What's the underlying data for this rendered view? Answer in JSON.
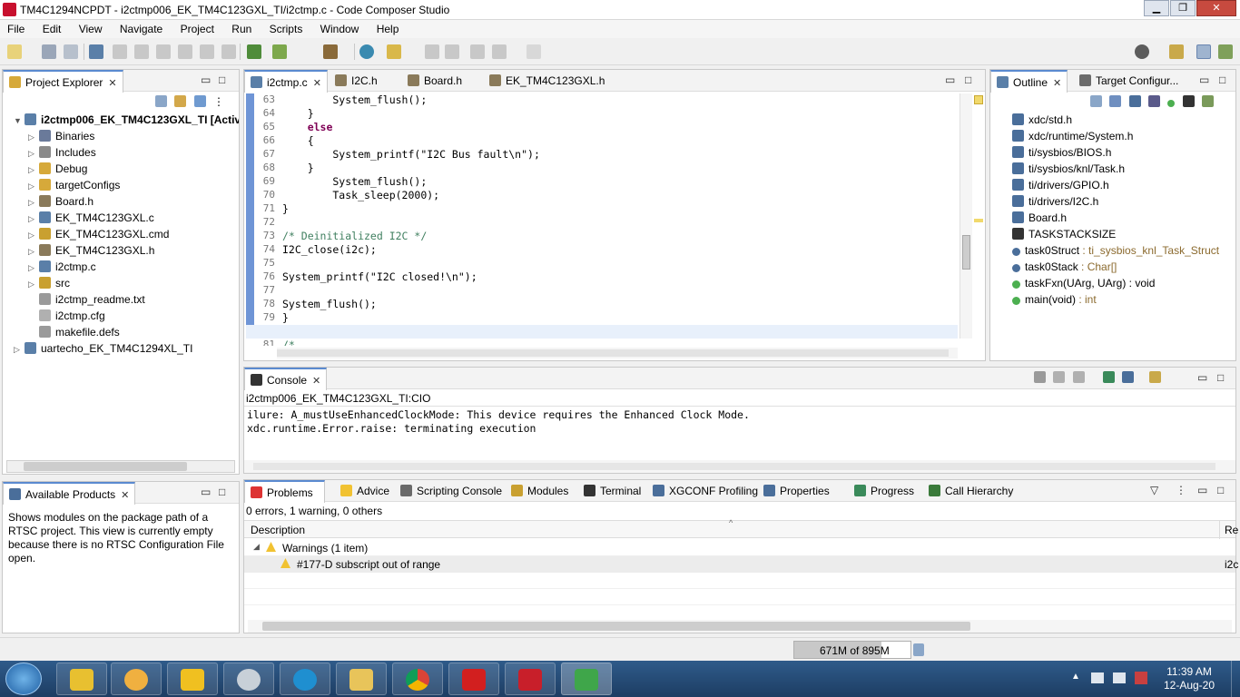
{
  "window": {
    "title": "TM4C1294NCPDT - i2ctmp006_EK_TM4C123GXL_TI/i2ctmp.c - Code Composer Studio",
    "min": "▁",
    "max": "❐",
    "close": "✕"
  },
  "menu": [
    "File",
    "Edit",
    "View",
    "Navigate",
    "Project",
    "Run",
    "Scripts",
    "Window",
    "Help"
  ],
  "project_explorer": {
    "title": "Project Explorer",
    "items": [
      {
        "label": "i2ctmp006_EK_TM4C123GXL_TI  [Active",
        "level": 0,
        "arrow": "▼",
        "bold": true
      },
      {
        "label": "Binaries",
        "level": 1,
        "arrow": "▷"
      },
      {
        "label": "Includes",
        "level": 1,
        "arrow": "▷"
      },
      {
        "label": "Debug",
        "level": 1,
        "arrow": "▷"
      },
      {
        "label": "targetConfigs",
        "level": 1,
        "arrow": "▷"
      },
      {
        "label": "Board.h",
        "level": 1,
        "arrow": "▷"
      },
      {
        "label": "EK_TM4C123GXL.c",
        "level": 1,
        "arrow": "▷"
      },
      {
        "label": "EK_TM4C123GXL.cmd",
        "level": 1,
        "arrow": "▷"
      },
      {
        "label": "EK_TM4C123GXL.h",
        "level": 1,
        "arrow": "▷"
      },
      {
        "label": "i2ctmp.c",
        "level": 1,
        "arrow": "▷"
      },
      {
        "label": "src",
        "level": 1,
        "arrow": "▷"
      },
      {
        "label": "i2ctmp_readme.txt",
        "level": 1,
        "arrow": ""
      },
      {
        "label": "i2ctmp.cfg",
        "level": 1,
        "arrow": ""
      },
      {
        "label": "makefile.defs",
        "level": 1,
        "arrow": ""
      },
      {
        "label": "uartecho_EK_TM4C1294XL_TI",
        "level": 0,
        "arrow": "▷"
      }
    ]
  },
  "available_products": {
    "title": "Available Products",
    "text": "Shows modules on the package path of a RTSC project. This view is currently empty because there is no RTSC Configuration File open."
  },
  "editor": {
    "tabs": [
      "i2ctmp.c",
      "I2C.h",
      "Board.h",
      "EK_TM4C123GXL.h"
    ],
    "lines": [
      {
        "n": "63",
        "code": "        System_flush();"
      },
      {
        "n": "64",
        "code": "    }"
      },
      {
        "n": "65",
        "code": "    else"
      },
      {
        "n": "66",
        "code": "    {"
      },
      {
        "n": "67",
        "code": "        System_printf(\"I2C Bus fault\\n\");"
      },
      {
        "n": "68",
        "code": "    }"
      },
      {
        "n": "69",
        "code": "        System_flush();"
      },
      {
        "n": "70",
        "code": "        Task_sleep(2000);"
      },
      {
        "n": "71",
        "code": "}"
      },
      {
        "n": "72",
        "code": ""
      },
      {
        "n": "73",
        "code": "/* Deinitialized I2C */"
      },
      {
        "n": "74",
        "code": "I2C_close(i2c);"
      },
      {
        "n": "75",
        "code": ""
      },
      {
        "n": "76",
        "code": "System_printf(\"I2C closed!\\n\");"
      },
      {
        "n": "77",
        "code": ""
      },
      {
        "n": "78",
        "code": "System_flush();"
      },
      {
        "n": "79",
        "code": "}"
      },
      {
        "n": "80",
        "code": ""
      },
      {
        "n": "81",
        "code": "/*"
      }
    ]
  },
  "outline": {
    "tabs": [
      "Outline",
      "Target Configur..."
    ],
    "items": [
      {
        "name": "xdc/std.h",
        "type": ""
      },
      {
        "name": "xdc/runtime/System.h",
        "type": ""
      },
      {
        "name": "ti/sysbios/BIOS.h",
        "type": ""
      },
      {
        "name": "ti/sysbios/knl/Task.h",
        "type": ""
      },
      {
        "name": "ti/drivers/GPIO.h",
        "type": ""
      },
      {
        "name": "ti/drivers/I2C.h",
        "type": ""
      },
      {
        "name": "Board.h",
        "type": ""
      },
      {
        "name": "TASKSTACKSIZE",
        "type": ""
      },
      {
        "name": "task0Struct",
        "type": " : ti_sysbios_knl_Task_Struct"
      },
      {
        "name": "task0Stack",
        "type": " : Char[]"
      },
      {
        "name": "taskFxn(UArg, UArg) : void",
        "type": ""
      },
      {
        "name": "main(void)",
        "type": " : int"
      }
    ]
  },
  "console": {
    "title": "Console",
    "header": "i2ctmp006_EK_TM4C123GXL_TI:CIO",
    "lines": [
      "ilure: A_mustUseEnhancedClockMode: This device requires the Enhanced Clock Mode.",
      "xdc.runtime.Error.raise: terminating execution"
    ]
  },
  "problems": {
    "tabs": [
      "Problems",
      "Advice",
      "Scripting Console",
      "Modules",
      "Terminal",
      "XGCONF Profiling",
      "Properties",
      "Progress",
      "Call Hierarchy"
    ],
    "summary": "0 errors, 1 warning, 0 others",
    "col_description": "Description",
    "col_resource": "Re",
    "group": "Warnings (1 item)",
    "warning": "#177-D subscript out of range",
    "warning_resource": "i2c"
  },
  "status": {
    "heap": "671M of 895M",
    "heap_fraction": 0.75
  },
  "taskbar": {
    "time": "11:39 AM",
    "date": "12-Aug-20"
  }
}
